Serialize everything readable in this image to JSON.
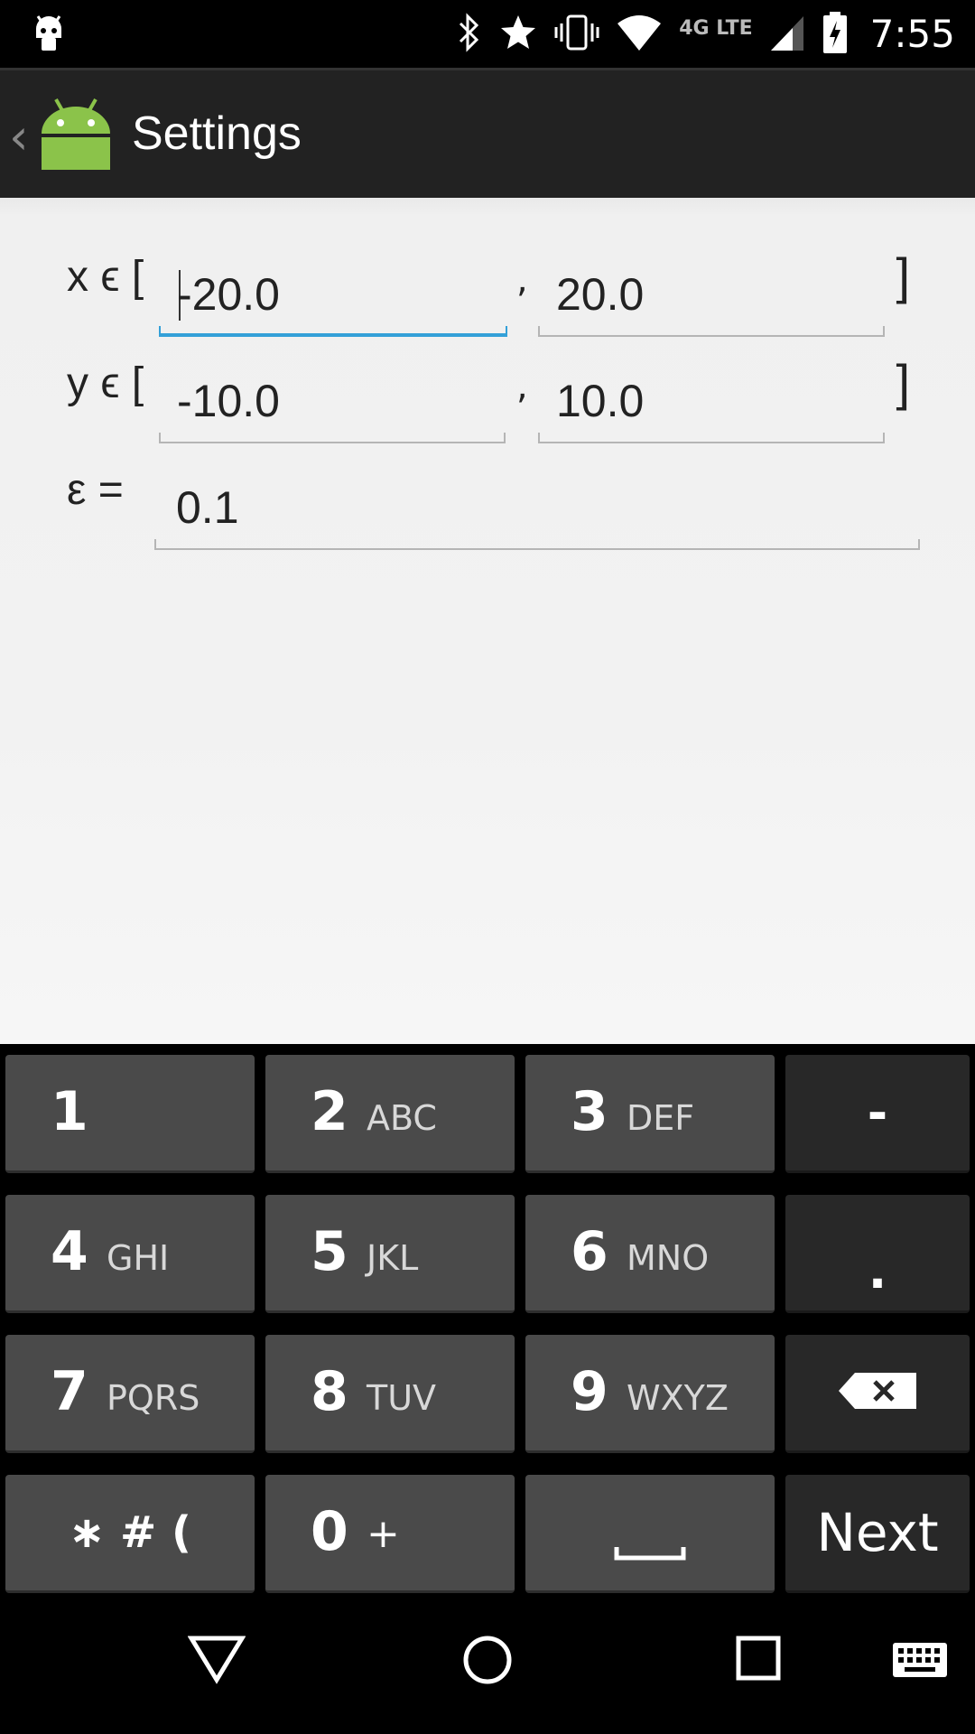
{
  "status_bar": {
    "time": "7:55",
    "network_type": "4G LTE",
    "icons": [
      "android-notification-icon",
      "bluetooth-icon",
      "star-icon",
      "vibrate-icon",
      "wifi-icon",
      "cell-signal-icon",
      "battery-charging-icon"
    ]
  },
  "action_bar": {
    "title": "Settings",
    "back_icon": "chevron-left-icon",
    "app_icon": "android-robot-icon"
  },
  "form": {
    "x_label": "x ϵ [",
    "x_min": "-20.0",
    "x_max": "20.0",
    "y_label": "y ϵ [",
    "y_min": "-10.0",
    "y_max": "10.0",
    "separator": ",",
    "close_bracket": "]",
    "eps_label": "ε =",
    "eps_value": "0.1",
    "focused_field": "x_min"
  },
  "keyboard": {
    "keys": [
      {
        "num": "1",
        "letters": ""
      },
      {
        "num": "2",
        "letters": "ABC"
      },
      {
        "num": "3",
        "letters": "DEF"
      },
      {
        "label": "-"
      },
      {
        "num": "4",
        "letters": "GHI"
      },
      {
        "num": "5",
        "letters": "JKL"
      },
      {
        "num": "6",
        "letters": "MNO"
      },
      {
        "label": "."
      },
      {
        "num": "7",
        "letters": "PQRS"
      },
      {
        "num": "8",
        "letters": "TUV"
      },
      {
        "num": "9",
        "letters": "WXYZ"
      },
      {
        "label": "backspace-icon"
      },
      {
        "label": "∗ # ("
      },
      {
        "num": "0",
        "letters": "+"
      },
      {
        "label": "space-icon"
      },
      {
        "label": "Next"
      }
    ]
  },
  "nav_bar": {
    "icons": [
      "back-triangle-icon",
      "home-circle-icon",
      "recents-square-icon",
      "keyboard-icon"
    ]
  },
  "colors": {
    "focus_accent": "#33a0d8",
    "android_green": "#8bc34a",
    "action_bar": "#222222",
    "key": "#4a4a4a",
    "key_dark": "#282828"
  }
}
